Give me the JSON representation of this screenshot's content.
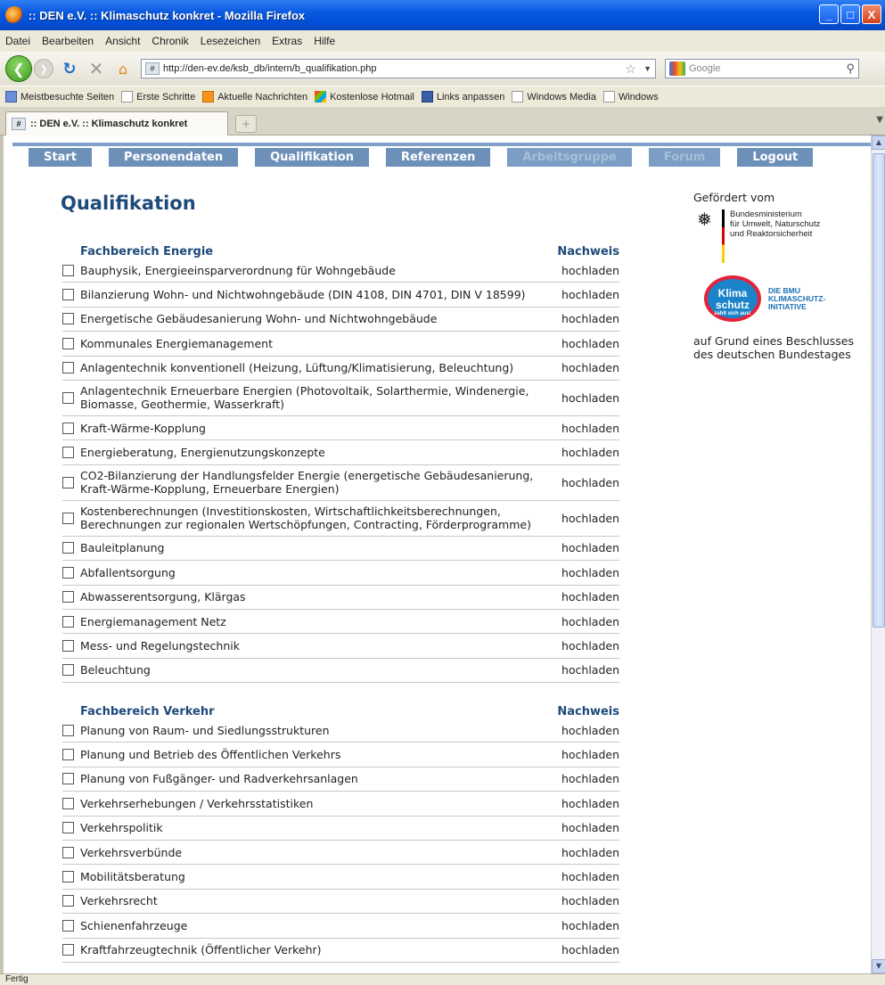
{
  "window": {
    "title": ":: DEN e.V. :: Klimaschutz konkret - Mozilla Firefox",
    "minimize": "_",
    "maximize": "□",
    "close": "X"
  },
  "menubar": {
    "items": [
      "Datei",
      "Bearbeiten",
      "Ansicht",
      "Chronik",
      "Lesezeichen",
      "Extras",
      "Hilfe"
    ]
  },
  "navbar": {
    "url": "http://den-ev.de/ksb_db/intern/b_qualifikation.php",
    "search_placeholder": "Google"
  },
  "bookmarks": [
    "Meistbesuchte Seiten",
    "Erste Schritte",
    "Aktuelle Nachrichten",
    "Kostenlose Hotmail",
    "Links anpassen",
    "Windows Media",
    "Windows"
  ],
  "tab": {
    "label": ":: DEN e.V. :: Klimaschutz konkret",
    "newtab": "+"
  },
  "sitenav": [
    {
      "label": "Start",
      "enabled": true
    },
    {
      "label": "Personendaten",
      "enabled": true
    },
    {
      "label": "Qualifikation",
      "enabled": true
    },
    {
      "label": "Referenzen",
      "enabled": true
    },
    {
      "label": "Arbeitsgruppe",
      "enabled": false
    },
    {
      "label": "Forum",
      "enabled": false
    },
    {
      "label": "Logout",
      "enabled": true
    }
  ],
  "page": {
    "title": "Qualifikation",
    "nachweis_header": "Nachweis",
    "upload_label": "hochladen"
  },
  "energie": {
    "header": "Fachbereich Energie",
    "items": [
      "Bauphysik, Energieeinsparverordnung für Wohngebäude",
      "Bilanzierung Wohn- und Nichtwohngebäude (DIN 4108, DIN 4701, DIN V 18599)",
      "Energetische Gebäudesanierung Wohn- und Nichtwohngebäude",
      "Kommunales Energiemanagement",
      "Anlagentechnik konventionell (Heizung, Lüftung/Klimatisierung, Beleuchtung)",
      "Anlagentechnik Erneuerbare Energien (Photovoltaik, Solarthermie, Windenergie, Biomasse, Geothermie, Wasserkraft)",
      "Kraft-Wärme-Kopplung",
      "Energieberatung, Energienutzungskonzepte",
      "CO2-Bilanzierung der Handlungsfelder Energie (energetische Gebäudesanierung, Kraft-Wärme-Kopplung, Erneuerbare Energien)",
      "Kostenberechnungen (Investitionskosten, Wirtschaftlichkeitsberechnungen, Berechnungen zur regionalen Wertschöpfungen, Contracting, Förderprogramme)",
      "Bauleitplanung",
      "Abfallentsorgung",
      "Abwasserentsorgung, Klärgas",
      "Energiemanagement Netz",
      "Mess- und Regelungstechnik",
      "Beleuchtung"
    ]
  },
  "verkehr": {
    "header": "Fachbereich Verkehr",
    "items": [
      "Planung von Raum- und Siedlungsstrukturen",
      "Planung und Betrieb des Öffentlichen Verkehrs",
      "Planung von Fußgänger- und Radverkehrsanlagen",
      "Verkehrserhebungen / Verkehrsstatistiken",
      "Verkehrspolitik",
      "Verkehrsverbünde",
      "Mobilitätsberatung",
      "Verkehrsrecht",
      "Schienenfahrzeuge",
      "Kraftfahrzeugtechnik (Öffentlicher Verkehr)"
    ]
  },
  "sidebar": {
    "gefoerdert": "Gefördert vom",
    "ministry_line1": "Bundesministerium",
    "ministry_line2": "für Umwelt, Naturschutz",
    "ministry_line3": "und Reaktorsicherheit",
    "klima_logo_line1": "Klima",
    "klima_logo_line2": "schutz",
    "klima_logo_sub": "zahlt sich aus!",
    "initiative_line1": "DIE BMU",
    "initiative_line2": "KLIMASCHUTZ-",
    "initiative_line3": "INITIATIVE",
    "beschluss_line1": "auf Grund eines Beschlusses",
    "beschluss_line2": "des deutschen Bundestages"
  },
  "status": "Fertig"
}
